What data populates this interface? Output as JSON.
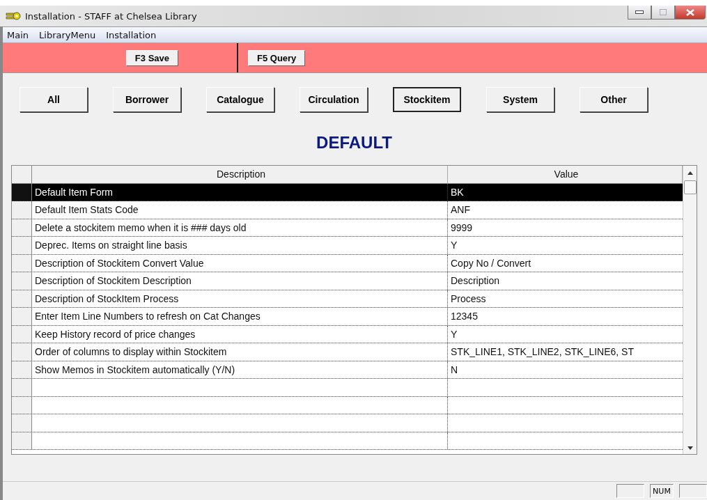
{
  "window": {
    "title": "Installation - STAFF at Chelsea Library"
  },
  "menu": [
    "Main",
    "LibraryMenu",
    "Installation"
  ],
  "toolbar": [
    "F3 Save",
    "F5 Query"
  ],
  "tabs": [
    {
      "label": "All",
      "selected": false
    },
    {
      "label": "Borrower",
      "selected": false
    },
    {
      "label": "Catalogue",
      "selected": false
    },
    {
      "label": "Circulation",
      "selected": false
    },
    {
      "label": "Stockitem",
      "selected": true
    },
    {
      "label": "System",
      "selected": false
    },
    {
      "label": "Other",
      "selected": false
    }
  ],
  "heading": "DEFAULT",
  "table": {
    "columns": [
      "Description",
      "Value"
    ],
    "rows": [
      {
        "description": "Default Item Form",
        "value": "BK",
        "selected": true
      },
      {
        "description": "Default Item Stats Code",
        "value": "ANF",
        "selected": false
      },
      {
        "description": "Delete a stockitem memo when it is ### days old",
        "value": "9999",
        "selected": false
      },
      {
        "description": "Deprec. Items on straight line basis",
        "value": "Y",
        "selected": false
      },
      {
        "description": "Description of Stockitem Convert Value",
        "value": "Copy No / Convert",
        "selected": false
      },
      {
        "description": "Description of Stockitem Description",
        "value": "Description",
        "selected": false
      },
      {
        "description": "Description of StockItem Process",
        "value": "Process",
        "selected": false
      },
      {
        "description": "Enter Item Line Numbers to refresh on Cat Changes",
        "value": "12345",
        "selected": false
      },
      {
        "description": "Keep History record of price changes",
        "value": "Y",
        "selected": false
      },
      {
        "description": "Order of columns to display within Stockitem",
        "value": "STK_LINE1, STK_LINE2, STK_LINE6, ST",
        "selected": false
      },
      {
        "description": "Show Memos in Stockitem automatically (Y/N)",
        "value": "N",
        "selected": false
      }
    ]
  },
  "status_bar": {
    "num": "NUM"
  }
}
